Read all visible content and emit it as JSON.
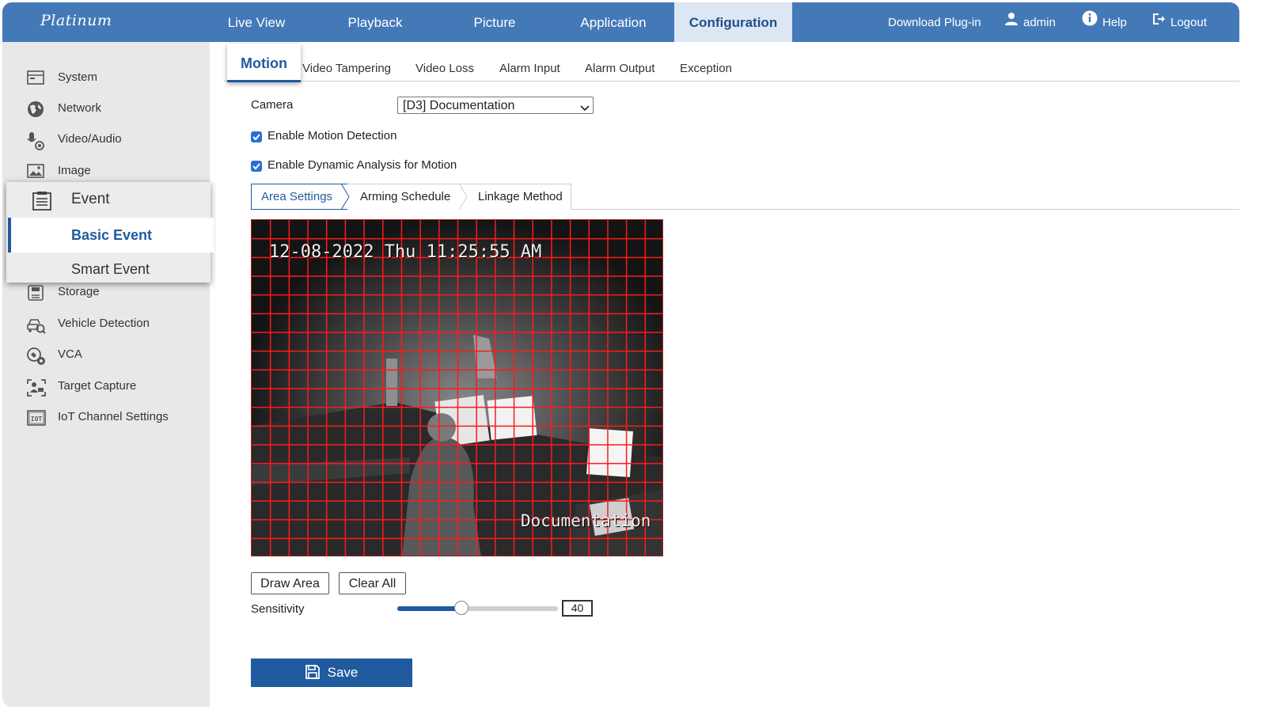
{
  "brand": {
    "name": "Platinum"
  },
  "nav": {
    "items": [
      {
        "label": "Live View"
      },
      {
        "label": "Playback"
      },
      {
        "label": "Picture"
      },
      {
        "label": "Application"
      },
      {
        "label": "Configuration",
        "active": true
      }
    ]
  },
  "topright": {
    "download": "Download Plug-in",
    "user": "admin",
    "help": "Help",
    "logout": "Logout"
  },
  "sidebar": {
    "items": [
      {
        "label": "System",
        "icon": "system-icon"
      },
      {
        "label": "Network",
        "icon": "globe-icon"
      },
      {
        "label": "Video/Audio",
        "icon": "video-audio-icon"
      },
      {
        "label": "Image",
        "icon": "image-icon"
      },
      {
        "label": "Storage",
        "icon": "storage-icon"
      },
      {
        "label": "Vehicle Detection",
        "icon": "vehicle-detection-icon"
      },
      {
        "label": "VCA",
        "icon": "vca-icon"
      },
      {
        "label": "Target Capture",
        "icon": "target-capture-icon"
      },
      {
        "label": "IoT Channel Settings",
        "icon": "iot-icon"
      }
    ],
    "event": {
      "label": "Event",
      "children": [
        {
          "label": "Basic Event",
          "active": true
        },
        {
          "label": "Smart Event"
        }
      ]
    }
  },
  "subtabs": {
    "active": "Motion",
    "others": [
      "Video Tampering",
      "Video Loss",
      "Alarm Input",
      "Alarm Output",
      "Exception"
    ]
  },
  "form": {
    "camera_label": "Camera",
    "camera_value": "[D3] Documentation",
    "enable_motion": {
      "label": "Enable Motion Detection",
      "checked": true
    },
    "enable_dynamic": {
      "label": "Enable Dynamic Analysis for Motion",
      "checked": true
    }
  },
  "inner_tabs": [
    {
      "label": "Area Settings",
      "active": true
    },
    {
      "label": "Arming Schedule"
    },
    {
      "label": "Linkage Method"
    }
  ],
  "video": {
    "timestamp": "12-08-2022 Thu 11:25:55 AM",
    "channel_name": "Documentation",
    "grid_color": "#ff1a1a"
  },
  "buttons": {
    "draw_area": "Draw Area",
    "clear_all": "Clear All",
    "save": "Save"
  },
  "sensitivity": {
    "label": "Sensitivity",
    "value": "40",
    "fraction": 0.4
  },
  "colors": {
    "topbar": "#4479b8",
    "accent": "#1f5b9e"
  }
}
